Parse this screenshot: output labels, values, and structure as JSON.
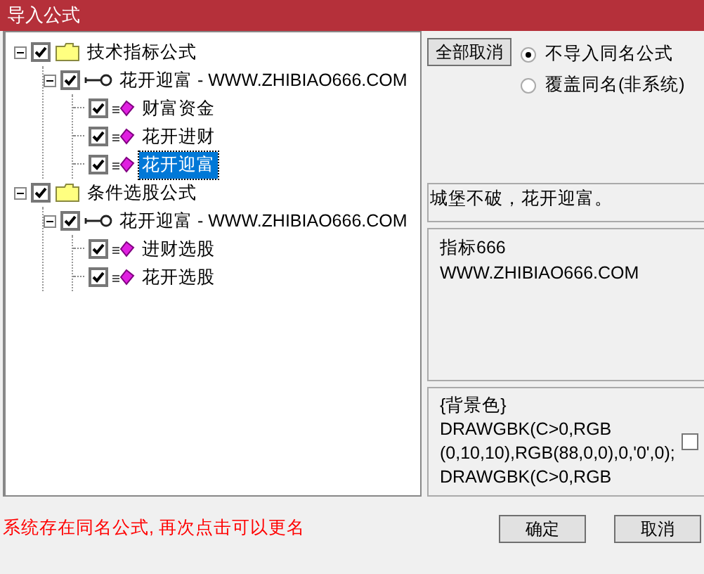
{
  "window": {
    "title": "导入公式"
  },
  "tree": [
    {
      "kind": "folder",
      "label": "技术指标公式",
      "checked": true,
      "expanded": true,
      "selected": false,
      "children": [
        {
          "kind": "key",
          "label": "花开迎富 - WWW.ZHIBIAO666.COM",
          "checked": true,
          "expanded": true,
          "selected": false,
          "children": [
            {
              "kind": "formula",
              "label": "财富资金",
              "checked": true,
              "selected": false
            },
            {
              "kind": "formula",
              "label": "花开进财",
              "checked": true,
              "selected": false
            },
            {
              "kind": "formula",
              "label": "花开迎富",
              "checked": true,
              "selected": true
            }
          ]
        }
      ]
    },
    {
      "kind": "folder",
      "label": "条件选股公式",
      "checked": true,
      "expanded": true,
      "selected": false,
      "children": [
        {
          "kind": "key",
          "label": "花开迎富 - WWW.ZHIBIAO666.COM",
          "checked": true,
          "expanded": true,
          "selected": false,
          "children": [
            {
              "kind": "formula",
              "label": "进财选股",
              "checked": true,
              "selected": false
            },
            {
              "kind": "formula",
              "label": "花开选股",
              "checked": true,
              "selected": false
            }
          ]
        }
      ]
    }
  ],
  "cancel_all_button": "全部取消",
  "options": [
    {
      "label": "不导入同名公式",
      "selected": true
    },
    {
      "label": "覆盖同名(非系统)",
      "selected": false
    }
  ],
  "description": "城堡不破，花开迎富。",
  "info": [
    "指标666",
    "WWW.ZHIBIAO666.COM"
  ],
  "code": {
    "lines": [
      "{背景色}",
      "DRAWGBK(C>0,RGB",
      "(0,10,10),RGB(88,0,0),0,'0',0);",
      "DRAWGBK(C>0,RGB"
    ],
    "checked": false
  },
  "status": "系统存在同名公式, 再次点击可以更名",
  "buttons": [
    "确定",
    "取消"
  ]
}
